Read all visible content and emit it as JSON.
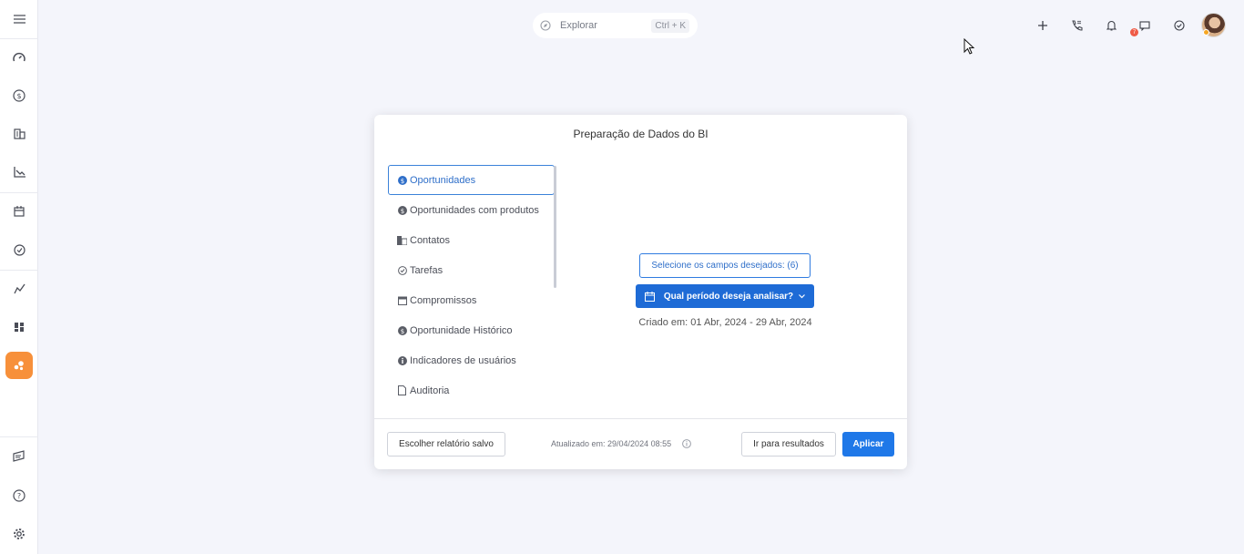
{
  "search": {
    "placeholder": "Explorar",
    "shortcut": "Ctrl + K"
  },
  "topbar": {
    "icons": [
      "plus-icon",
      "phone-dialpad-icon",
      "bell-icon",
      "chat-icon",
      "check-circle-icon",
      "user-avatar"
    ],
    "notification_badge": "7"
  },
  "sidebar": {
    "items": [
      "menu-icon",
      "dashboard-icon",
      "dollar-icon",
      "building-icon",
      "chart-icon",
      "calendar-icon",
      "check-icon",
      "trend-icon",
      "widgets-icon",
      "bi-icon",
      "feedback-icon",
      "help-icon",
      "settings-icon"
    ],
    "active_color": "#f7903a"
  },
  "modal": {
    "title": "Preparação de Dados do BI",
    "list": [
      {
        "label": "Oportunidades",
        "icon": "dollar-circle-icon"
      },
      {
        "label": "Oportunidades com produtos",
        "icon": "dollar-circle-icon"
      },
      {
        "label": "Contatos",
        "icon": "building-icon"
      },
      {
        "label": "Tarefas",
        "icon": "check-circle-icon"
      },
      {
        "label": "Compromissos",
        "icon": "calendar-icon"
      },
      {
        "label": "Oportunidade Histórico",
        "icon": "dollar-circle-icon"
      },
      {
        "label": "Indicadores de usuários",
        "icon": "info-icon"
      },
      {
        "label": "Auditoria",
        "icon": "document-icon"
      }
    ],
    "fields_button": "Selecione os campos desejados: (6)",
    "period_button": "Qual período deseja analisar?",
    "created": "Criado em: 01 Abr, 2024 - 29 Abr, 2024",
    "footer": {
      "saved_report": "Escolher relatório salvo",
      "updated": "Atualizado em: 29/04/2024 08:55",
      "results": "Ir para resultados",
      "apply": "Aplicar"
    }
  },
  "colors": {
    "primary": "#1e6bd6",
    "accent": "#f7903a",
    "background": "#f4f5fb"
  }
}
